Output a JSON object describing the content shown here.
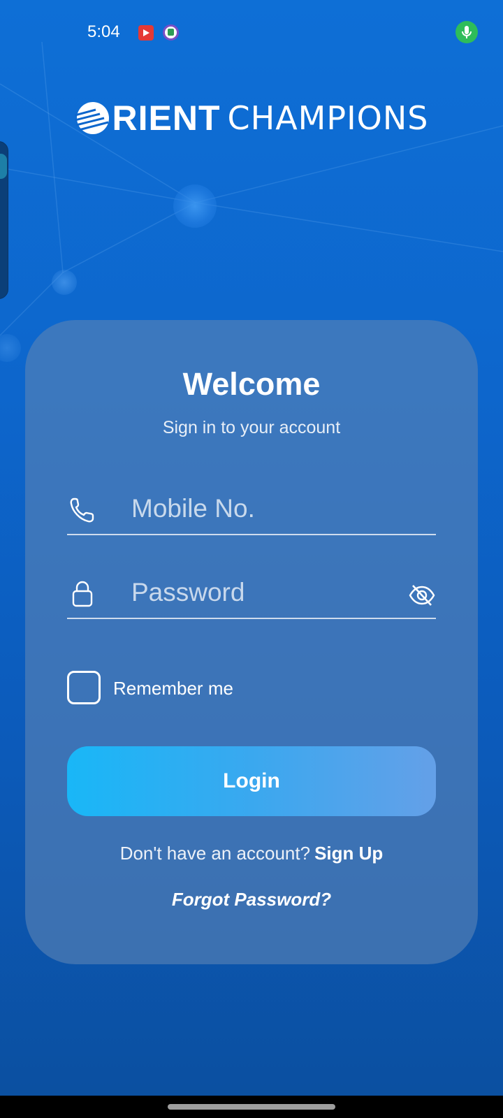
{
  "status_bar": {
    "time": "5:04",
    "icons": [
      "youtube-icon",
      "app-notification-icon",
      "mic-icon"
    ]
  },
  "logo": {
    "bold": "RIENT",
    "light": "CHAMPIONS",
    "mark": "orient-logo-mark"
  },
  "login_card": {
    "title": "Welcome",
    "subtitle": "Sign in to your account",
    "mobile": {
      "placeholder": "Mobile No.",
      "value": "",
      "icon": "phone-icon"
    },
    "password": {
      "placeholder": "Password",
      "value": "",
      "icon": "lock-icon",
      "toggle_icon": "eye-off-icon"
    },
    "remember_label": "Remember me",
    "remember_checked": false,
    "login_label": "Login",
    "signup_prompt": "Don't have an account?",
    "signup_label": "Sign Up",
    "forgot_label": "Forgot Password?"
  },
  "colors": {
    "background": "#0d66cc",
    "button_start": "#19b7f7",
    "button_end": "#64a0e8"
  }
}
